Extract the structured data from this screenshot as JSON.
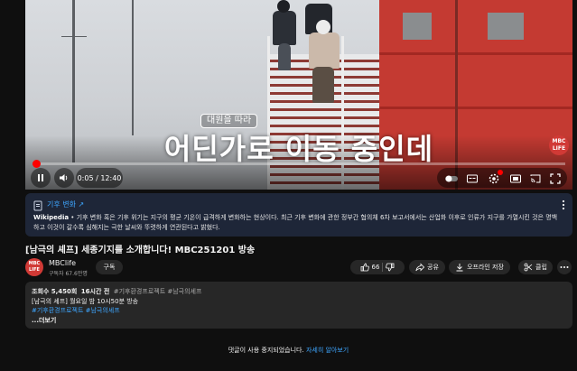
{
  "player": {
    "caption_label": "대원을 따라",
    "caption": "어딘가로 이동 중인데",
    "channel_badge": "MBC\nLIFE",
    "time": "0:05 / 12:40",
    "progress_fraction": 0.0066,
    "icons": [
      "play-pause-icon",
      "volume-icon",
      "autoplay-toggle-icon",
      "subtitles-icon",
      "settings-icon",
      "miniplayer-icon",
      "cast-icon",
      "fullscreen-icon"
    ]
  },
  "info_panel": {
    "topic": "기후 변화",
    "source": "Wikipedia",
    "text": " • 기후 변화 혹은 기후 위기는 지구의 평균 기온이 급격하게 변화하는 현상이다. 최근 기후 변화에 관한 정부간 협의체 6차 보고서에서는 산업화 이후로 인류가 지구를 가열시킨 것은 명백하고 이것이 갈수록 심해지는 극한 날씨와 뚜렷하게 연관된다고 밝혔다."
  },
  "video": {
    "title": "[남극의 셰프] 세종기지를 소개합니다! MBC251201 방송"
  },
  "channel": {
    "avatar_text": "MBC LIFE",
    "name": "MBClife",
    "subscribers": "구독자 67.6만명",
    "subscribe_label": "구독"
  },
  "actions": {
    "like_count": "66",
    "share_label": "공유",
    "offline_label": "오프라인 저장",
    "clip_label": "클립"
  },
  "description": {
    "views": "조회수 5,450회",
    "age": "16시간 전",
    "meta_tags": "#기후환경프로젝트 #남극의셰프",
    "schedule": "[남극의 셰프] 월요일 밤 10시50분 방송",
    "hashtags": "#기후환경프로젝트 #남극의셰프",
    "more_label": "...더보기"
  },
  "comments": {
    "off_text": "댓글이 사용 중지되었습니다.",
    "learn_more": "자세히 알아보기"
  },
  "colors": {
    "accent_red": "#ff0000",
    "link_blue": "#3ea6ff",
    "background": "#0f0f0f"
  }
}
